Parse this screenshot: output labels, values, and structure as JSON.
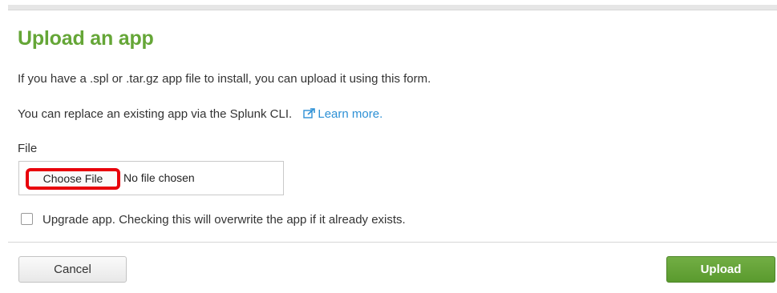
{
  "form": {
    "title": "Upload an app",
    "description": "If you have a .spl or .tar.gz app file to install, you can upload it using this form.",
    "replace_text": "You can replace an existing app via the Splunk CLI.",
    "learn_more_label": "Learn more.",
    "learn_more_icon": "external-link-icon",
    "file_label": "File",
    "choose_file_label": "Choose File",
    "no_file_text": "No file chosen",
    "upgrade_label": "Upgrade app. Checking this will overwrite the app if it already exists.",
    "upgrade_checked": false,
    "cancel_label": "Cancel",
    "upload_label": "Upload"
  },
  "colors": {
    "title_green": "#65a637",
    "link_blue": "#2d90d5",
    "upload_green": "#5a9a2e",
    "highlight_red": "#e8000b"
  }
}
